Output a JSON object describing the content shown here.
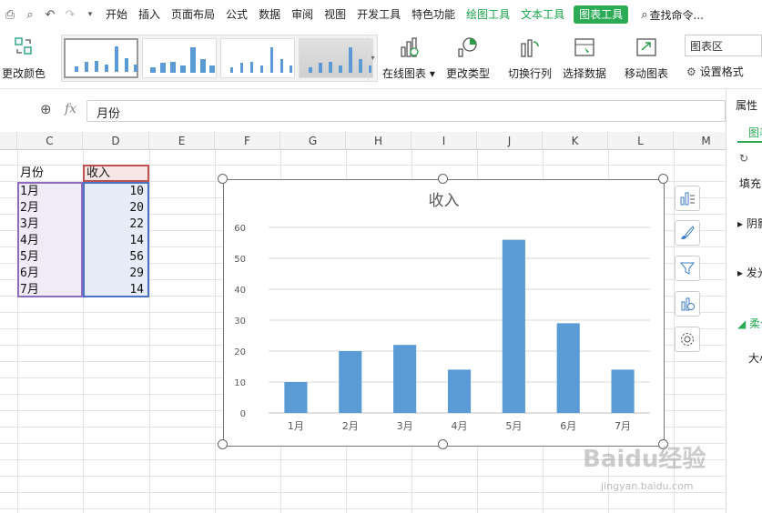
{
  "menubar": {
    "items": [
      "开始",
      "插入",
      "页面布局",
      "公式",
      "数据",
      "审阅",
      "视图",
      "开发工具",
      "特色功能"
    ],
    "context_tabs": [
      "绘图工具",
      "文本工具"
    ],
    "active_tab": "图表工具",
    "search": "查找命令..."
  },
  "ribbon": {
    "change_color": "更改颜色",
    "online_chart": "在线图表",
    "change_type": "更改类型",
    "switch_rowcol": "切换行列",
    "select_data": "选择数据",
    "move_chart": "移动图表",
    "chart_area": "图表区",
    "set_format": "设置格式"
  },
  "formula_bar": {
    "fx": "fx",
    "value": "月份"
  },
  "columns": [
    "C",
    "D",
    "E",
    "F",
    "G",
    "H",
    "I",
    "J",
    "K",
    "L",
    "M"
  ],
  "table": {
    "headers": [
      "月份",
      "收入"
    ],
    "rows": [
      {
        "month": "1月",
        "income": "10"
      },
      {
        "month": "2月",
        "income": "20"
      },
      {
        "month": "3月",
        "income": "22"
      },
      {
        "month": "4月",
        "income": "14"
      },
      {
        "month": "5月",
        "income": "56"
      },
      {
        "month": "6月",
        "income": "29"
      },
      {
        "month": "7月",
        "income": "14"
      }
    ]
  },
  "right_panel": {
    "title": "属性",
    "tab": "图表",
    "fill": "填充",
    "shadow": "阴影",
    "glow": "发光",
    "soft": "柔化",
    "size": "大小"
  },
  "watermark": {
    "brand": "Baidu经验",
    "url": "jingyan.baidu.com"
  },
  "chart_data": {
    "type": "bar",
    "title": "收入",
    "categories": [
      "1月",
      "2月",
      "3月",
      "4月",
      "5月",
      "6月",
      "7月"
    ],
    "values": [
      10,
      20,
      22,
      14,
      56,
      29,
      14
    ],
    "y_ticks": [
      "0",
      "10",
      "20",
      "30",
      "40",
      "50",
      "60"
    ],
    "ylim": [
      0,
      60
    ],
    "grid": true,
    "bar_color": "#5b9bd5",
    "gridline_color": "#d9d9d9"
  },
  "colors": {
    "accent_green": "#2bab56",
    "context_green": "#17a34a",
    "selection_purple": "#8e6bbf",
    "selection_blue": "#4a72c4",
    "header_red": "#c0504d"
  }
}
